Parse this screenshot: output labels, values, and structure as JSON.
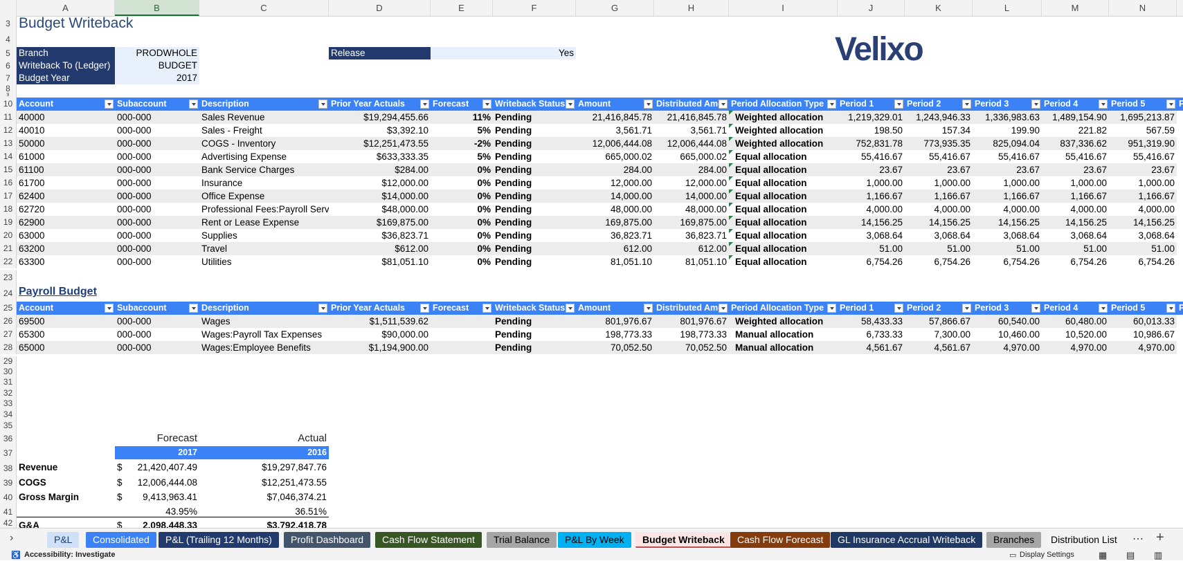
{
  "sheet": {
    "title": "Budget Writeback",
    "logo_text": "Velixo",
    "columns": [
      "A",
      "B",
      "C",
      "D",
      "E",
      "F",
      "G",
      "H",
      "I",
      "J",
      "K",
      "L",
      "M",
      "N"
    ],
    "row_numbers": [
      "3",
      "4",
      "5",
      "6",
      "7",
      "8",
      "9",
      "10",
      "11",
      "12",
      "13",
      "14",
      "15",
      "16",
      "17",
      "18",
      "19",
      "20",
      "21",
      "22",
      "23",
      "24",
      "25",
      "26",
      "27",
      "28",
      "29",
      "30",
      "31",
      "32",
      "33",
      "34",
      "35",
      "36",
      "37",
      "38",
      "39",
      "40",
      "41",
      "42"
    ],
    "params": [
      {
        "label": "Branch",
        "value": "PRODWHOLE"
      },
      {
        "label": "Writeback To (Ledger)",
        "value": "BUDGET"
      },
      {
        "label": "Budget Year",
        "value": "2017"
      }
    ],
    "release": {
      "label": "Release",
      "value": "Yes"
    }
  },
  "table1": {
    "headers": [
      "Account",
      "Subaccount",
      "Description",
      "Prior Year Actuals",
      "Forecast",
      "Writeback Status",
      "Amount",
      "Distributed Amo",
      "Period Allocation Type",
      "Period 1",
      "Period 2",
      "Period 3",
      "Period 4",
      "Period 5",
      "P"
    ],
    "rows": [
      [
        "40000",
        "000-000",
        "Sales Revenue",
        "$19,294,455.66",
        "11%",
        "Pending",
        "21,416,845.78",
        "21,416,845.78",
        "Weighted allocation",
        "1,219,329.01",
        "1,243,946.33",
        "1,336,983.63",
        "1,489,154.90",
        "1,695,213.87"
      ],
      [
        "40010",
        "000-000",
        "Sales - Freight",
        "$3,392.10",
        "5%",
        "Pending",
        "3,561.71",
        "3,561.71",
        "Weighted allocation",
        "198.50",
        "157.34",
        "199.90",
        "221.82",
        "567.59"
      ],
      [
        "50000",
        "000-000",
        "COGS - Inventory",
        "$12,251,473.55",
        "-2%",
        "Pending",
        "12,006,444.08",
        "12,006,444.08",
        "Weighted allocation",
        "752,831.78",
        "773,935.35",
        "825,094.04",
        "837,336.62",
        "951,319.90"
      ],
      [
        "61000",
        "000-000",
        "Advertising Expense",
        "$633,333.35",
        "5%",
        "Pending",
        "665,000.02",
        "665,000.02",
        "Equal allocation",
        "55,416.67",
        "55,416.67",
        "55,416.67",
        "55,416.67",
        "55,416.67"
      ],
      [
        "61100",
        "000-000",
        "Bank Service Charges",
        "$284.00",
        "0%",
        "Pending",
        "284.00",
        "284.00",
        "Equal allocation",
        "23.67",
        "23.67",
        "23.67",
        "23.67",
        "23.67"
      ],
      [
        "61700",
        "000-000",
        "Insurance",
        "$12,000.00",
        "0%",
        "Pending",
        "12,000.00",
        "12,000.00",
        "Equal allocation",
        "1,000.00",
        "1,000.00",
        "1,000.00",
        "1,000.00",
        "1,000.00"
      ],
      [
        "62400",
        "000-000",
        "Office Expense",
        "$14,000.00",
        "0%",
        "Pending",
        "14,000.00",
        "14,000.00",
        "Equal allocation",
        "1,166.67",
        "1,166.67",
        "1,166.67",
        "1,166.67",
        "1,166.67"
      ],
      [
        "62720",
        "000-000",
        "Professional Fees:Payroll Serv",
        "$48,000.00",
        "0%",
        "Pending",
        "48,000.00",
        "48,000.00",
        "Equal allocation",
        "4,000.00",
        "4,000.00",
        "4,000.00",
        "4,000.00",
        "4,000.00"
      ],
      [
        "62900",
        "000-000",
        "Rent or Lease Expense",
        "$169,875.00",
        "0%",
        "Pending",
        "169,875.00",
        "169,875.00",
        "Equal allocation",
        "14,156.25",
        "14,156.25",
        "14,156.25",
        "14,156.25",
        "14,156.25"
      ],
      [
        "63000",
        "000-000",
        "Supplies",
        "$36,823.71",
        "0%",
        "Pending",
        "36,823.71",
        "36,823.71",
        "Equal allocation",
        "3,068.64",
        "3,068.64",
        "3,068.64",
        "3,068.64",
        "3,068.64"
      ],
      [
        "63200",
        "000-000",
        "Travel",
        "$612.00",
        "0%",
        "Pending",
        "612.00",
        "612.00",
        "Equal allocation",
        "51.00",
        "51.00",
        "51.00",
        "51.00",
        "51.00"
      ],
      [
        "63300",
        "000-000",
        "Utilities",
        "$81,051.10",
        "0%",
        "Pending",
        "81,051.10",
        "81,051.10",
        "Equal allocation",
        "6,754.26",
        "6,754.26",
        "6,754.26",
        "6,754.26",
        "6,754.26"
      ]
    ]
  },
  "table2": {
    "title": "Payroll Budget",
    "headers": [
      "Account",
      "Subaccount",
      "Description",
      "Prior Year Actuals",
      "Forecast",
      "Writeback Status",
      "Amount",
      "Distributed Amo",
      "Period Allocation Type",
      "Period 1",
      "Period 2",
      "Period 3",
      "Period 4",
      "Period 5",
      "P"
    ],
    "rows": [
      [
        "69500",
        "000-000",
        "Wages",
        "$1,511,539.62",
        "",
        "Pending",
        "801,976.67",
        "801,976.67",
        "Weighted allocation",
        "58,433.33",
        "57,866.67",
        "60,540.00",
        "60,480.00",
        "60,013.33"
      ],
      [
        "65300",
        "000-000",
        "Wages:Payroll Tax Expenses",
        "$90,000.00",
        "",
        "Pending",
        "198,773.33",
        "198,773.33",
        "Manual allocation",
        "6,733.33",
        "7,300.00",
        "10,460.00",
        "10,520.00",
        "10,986.67"
      ],
      [
        "65000",
        "000-000",
        "Wages:Employee Benefits",
        "$1,194,900.00",
        "",
        "Pending",
        "70,052.50",
        "70,052.50",
        "Manual allocation",
        "4,561.67",
        "4,561.67",
        "4,970.00",
        "4,970.00",
        "4,970.00"
      ]
    ]
  },
  "summary": {
    "forecast_label": "Forecast",
    "actual_label": "Actual",
    "forecast_year": "2017",
    "actual_year": "2016",
    "rows": [
      {
        "label": "Revenue",
        "cur": "$",
        "forecast": "21,420,407.49",
        "actual": "$19,297,847.76"
      },
      {
        "label": "COGS",
        "cur": "$",
        "forecast": "12,006,444.08",
        "actual": "$12,251,473.55"
      },
      {
        "label": "Gross Margin",
        "cur": "$",
        "forecast": "9,413,963.41",
        "actual": "$7,046,374.21"
      },
      {
        "label": "",
        "cur": "",
        "forecast": "43.95%",
        "actual": "36.51%"
      },
      {
        "label": "G&A",
        "cur": "$",
        "forecast": "2,098,448.33",
        "actual": "$3,792,418.78"
      }
    ]
  },
  "tabs": [
    {
      "label": "P&L",
      "bg": "#cfe0f7",
      "fg": "#1f3f7a"
    },
    {
      "label": "Consolidated",
      "bg": "#3b82f6",
      "fg": "#ffffff"
    },
    {
      "label": "P&L (Trailing 12 Months)",
      "bg": "#223a6e",
      "fg": "#ffffff"
    },
    {
      "label": "Profit Dashboard",
      "bg": "#44546a",
      "fg": "#ffffff"
    },
    {
      "label": "Cash Flow Statement",
      "bg": "#375623",
      "fg": "#ffffff"
    },
    {
      "label": "Trial Balance",
      "bg": "#a6a6a6",
      "fg": "#000000"
    },
    {
      "label": "P&L By Week",
      "bg": "#00b0f0",
      "fg": "#000000"
    },
    {
      "label": "Budget Writeback",
      "bg": "#fbe4e4",
      "fg": "#000000"
    },
    {
      "label": "Cash Flow Forecast",
      "bg": "#843c0c",
      "fg": "#ffffff"
    },
    {
      "label": "GL Insurance Accrual Writeback",
      "bg": "#1f3864",
      "fg": "#ffffff"
    },
    {
      "label": "Branches",
      "bg": "#a6a6a6",
      "fg": "#000000"
    },
    {
      "label": "Distribution List",
      "bg": "#f3f3f3",
      "fg": "#000000"
    }
  ],
  "status": {
    "accessibility": "Accessibility: Investigate",
    "display_settings": "Display Settings"
  }
}
